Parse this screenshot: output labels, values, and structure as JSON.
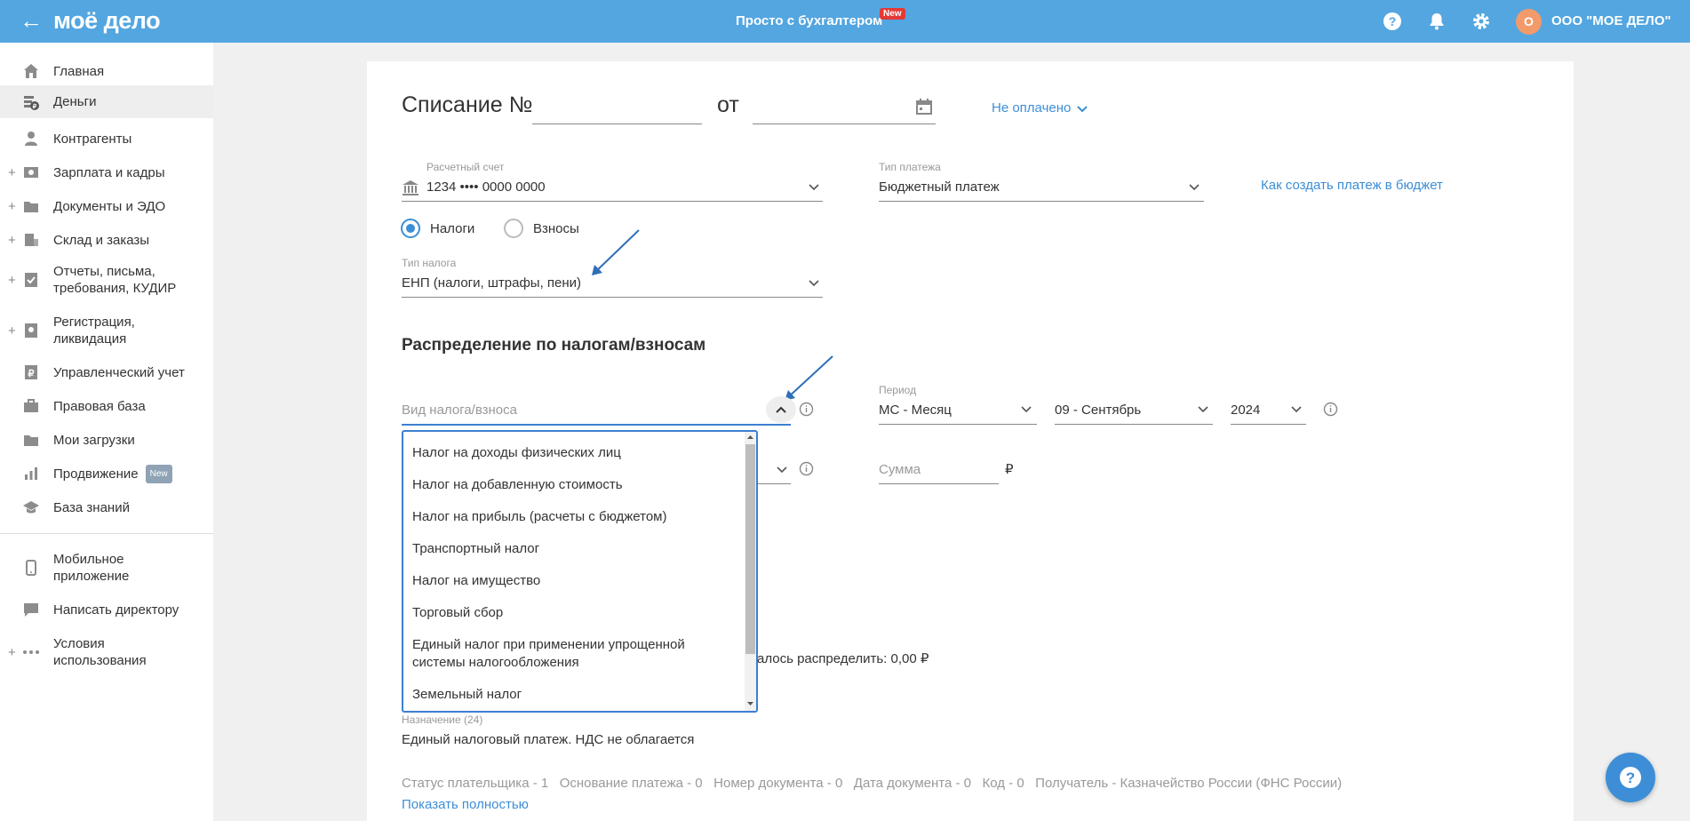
{
  "topbar": {
    "logo": "моё дело",
    "center_text": "Просто с бухгалтером",
    "new_badge": "New",
    "avatar_letter": "О",
    "company": "ООО \"МОЕ ДЕЛО\"",
    "accent_color": "#53a6e0"
  },
  "sidebar": {
    "items": [
      {
        "label": "Главная",
        "icon": "home-icon"
      },
      {
        "label": "Деньги",
        "icon": "money-icon"
      },
      {
        "label": "Контрагенты",
        "icon": "contractors-icon"
      },
      {
        "label": "Зарплата и кадры",
        "icon": "salary-icon"
      },
      {
        "label": "Документы и ЭДО",
        "icon": "folder-icon"
      },
      {
        "label": "Склад и заказы",
        "icon": "warehouse-icon"
      },
      {
        "label": "Отчеты, письма, требования, КУДИР",
        "icon": "reports-icon"
      },
      {
        "label": "Регистрация, ликвидация",
        "icon": "registration-icon"
      },
      {
        "label": "Управленческий учет",
        "icon": "management-icon"
      },
      {
        "label": "Правовая база",
        "icon": "briefcase-icon"
      },
      {
        "label": "Мои загрузки",
        "icon": "folder-icon"
      },
      {
        "label": "Продвижение",
        "icon": "promotion-icon",
        "badge": "New"
      },
      {
        "label": "База знаний",
        "icon": "graduation-cap-icon"
      },
      {
        "label": "Мобильное приложение",
        "icon": "mobile-icon"
      },
      {
        "label": "Написать директору",
        "icon": "chat-icon"
      },
      {
        "label": "Условия использования",
        "icon": "more-dots-icon"
      }
    ]
  },
  "form": {
    "title": "Списание №",
    "from_label": "от",
    "status": "Не оплачено",
    "account_label": "Расчетный счет",
    "account_value": "1234 •••• 0000 0000",
    "payment_type_label": "Тип платежа",
    "payment_type_value": "Бюджетный платеж",
    "budget_help_link": "Как создать платеж в бюджет",
    "radio_taxes": "Налоги",
    "radio_contributions": "Взносы",
    "tax_type_label": "Тип налога",
    "tax_type_value": "ЕНП (налоги, штрафы, пени)",
    "distribution_title": "Распределение по налогам/взносам",
    "tax_kind_placeholder": "Вид налога/взноса",
    "period_label": "Период",
    "period_value": "МС - Месяц",
    "month_value": "09 - Сентябрь",
    "year_value": "2024",
    "amount_placeholder": "Сумма",
    "currency": "₽",
    "remaining_text": "алось распределить: 0,00 ₽",
    "purpose_label": "Назначение (24)",
    "purpose_value": "Единый налоговый платеж. НДС не облагается",
    "details_line": "Статус плательщика - 1   Основание платежа - 0   Номер документа - 0   Дата документа - 0   Код - 0   Получатель - Казначейство России (ФНС России)",
    "show_full_link": "Показать полностью"
  },
  "dropdown": {
    "options": [
      "Налог на доходы физических лиц",
      "Налог на добавленную стоимость",
      "Налог на прибыль (расчеты с бюджетом)",
      "Транспортный налог",
      "Налог на имущество",
      "Торговый сбор",
      "Единый налог при применении упрощенной системы налогообложения",
      "Земельный налог"
    ]
  }
}
